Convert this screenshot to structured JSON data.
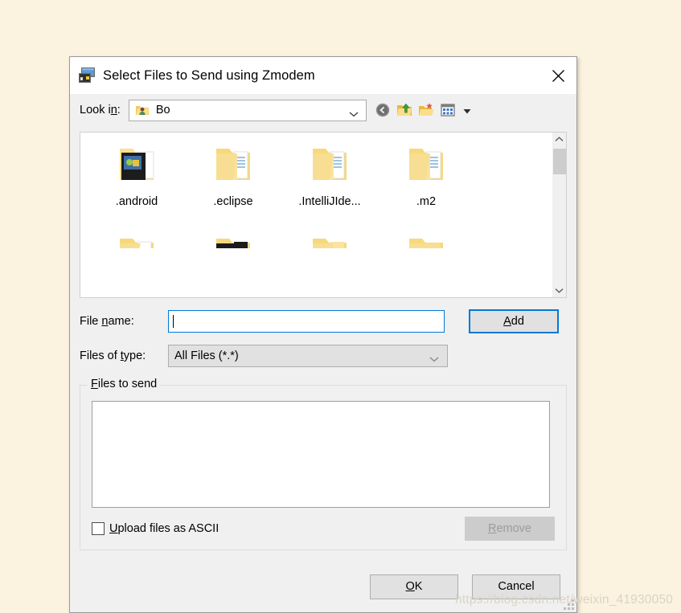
{
  "window": {
    "title": "Select Files to Send using Zmodem",
    "app_icon": "window-stack-icon",
    "close_icon": "close-icon"
  },
  "lookin": {
    "label": "Look in:",
    "value": "Bo",
    "value_icon": "user-folder-icon",
    "dropdown_icon": "chevron-down-icon",
    "toolbar": [
      {
        "name": "back-button",
        "icon": "back-arrow-icon"
      },
      {
        "name": "up-one-level-button",
        "icon": "up-folder-icon"
      },
      {
        "name": "create-new-folder-button",
        "icon": "new-folder-icon"
      },
      {
        "name": "view-menu-button",
        "icon": "views-grid-icon"
      },
      {
        "name": "view-menu-caret",
        "icon": "caret-down-icon"
      }
    ]
  },
  "file_list": {
    "row1": [
      {
        "name": ".android",
        "icon": "folder-android-icon"
      },
      {
        "name": ".eclipse",
        "icon": "folder-icon"
      },
      {
        "name": ".IntelliJIde...",
        "icon": "folder-icon"
      },
      {
        "name": ".m2",
        "icon": "folder-icon"
      }
    ],
    "row2": [
      {
        "name": "",
        "icon": "folder-icon"
      },
      {
        "name": "",
        "icon": "folder-dark-icon"
      },
      {
        "name": "",
        "icon": "folder-icon"
      },
      {
        "name": "",
        "icon": "folder-icon"
      }
    ],
    "scrollbar": {
      "up_icon": "chevron-up-icon",
      "down_icon": "chevron-down-icon"
    }
  },
  "form": {
    "file_name_label": "File name:",
    "file_name_value": "",
    "file_name_placeholder": "",
    "files_of_type_label": "Files of type:",
    "files_of_type_value": "All Files (*.*)",
    "files_of_type_options": [
      "All Files (*.*)"
    ],
    "add_label": "Add"
  },
  "files_to_send": {
    "group_title": "Files to send",
    "items": [],
    "checkbox_label": "Upload files as ASCII",
    "checkbox_checked": false,
    "remove_label": "Remove",
    "remove_enabled": false
  },
  "footer": {
    "ok_label": "OK",
    "cancel_label": "Cancel"
  },
  "watermark": {
    "text": "https://blog.csdn.net/weixin_41930050"
  },
  "colors": {
    "page_background": "#FBF3DF",
    "dialog_background": "#F0F0F0",
    "accent": "#0078D7",
    "folder_yellow": "#F6D97B",
    "disabled_text": "#9C9C9C"
  }
}
